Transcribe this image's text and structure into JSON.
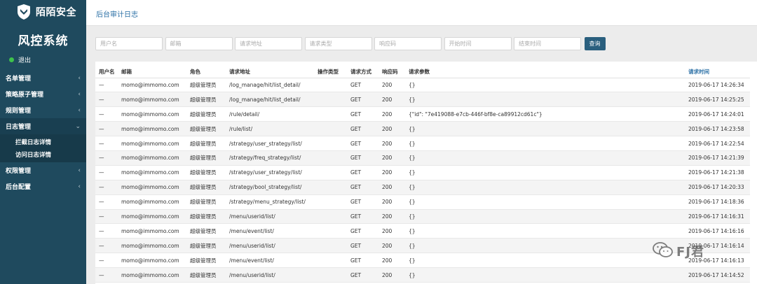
{
  "brand": {
    "name": "陌陌安全",
    "system_title": "风控系统",
    "logout": "退出"
  },
  "nav": [
    {
      "label": "名单管理",
      "open": false,
      "children": []
    },
    {
      "label": "策略原子管理",
      "open": false,
      "children": []
    },
    {
      "label": "规则管理",
      "open": false,
      "children": []
    },
    {
      "label": "日志管理",
      "open": true,
      "children": [
        "拦截日志详情",
        "访问日志详情"
      ]
    },
    {
      "label": "权限管理",
      "open": false,
      "children": []
    },
    {
      "label": "后台配置",
      "open": false,
      "children": []
    }
  ],
  "header": {
    "title": "后台审计日志"
  },
  "filters": {
    "username": "用户名",
    "email": "邮箱",
    "path": "请求地址",
    "type": "请求类型",
    "code": "响应码",
    "start": "开始时间",
    "end": "结束时间",
    "query": "查询"
  },
  "columns": [
    "用户名",
    "邮箱",
    "角色",
    "请求地址",
    "操作类型",
    "请求方式",
    "响应码",
    "请求参数",
    "请求时间"
  ],
  "rows": [
    {
      "user": "—",
      "email": "momo@immomo.com",
      "role": "超级管理员",
      "path": "/log_manage/hit/list_detail/",
      "op": "",
      "method": "GET",
      "code": "200",
      "params": "{}",
      "time": "2019-06-17 14:26:34"
    },
    {
      "user": "—",
      "email": "momo@immomo.com",
      "role": "超级管理员",
      "path": "/log_manage/hit/list_detail/",
      "op": "",
      "method": "GET",
      "code": "200",
      "params": "{}",
      "time": "2019-06-17 14:25:25"
    },
    {
      "user": "—",
      "email": "momo@immomo.com",
      "role": "超级管理员",
      "path": "/rule/detail/",
      "op": "",
      "method": "GET",
      "code": "200",
      "params": "{\"id\": \"7e419088-e7cb-446f-bf8e-ca89912cd61c\"}",
      "time": "2019-06-17 14:24:01"
    },
    {
      "user": "—",
      "email": "momo@immomo.com",
      "role": "超级管理员",
      "path": "/rule/list/",
      "op": "",
      "method": "GET",
      "code": "200",
      "params": "{}",
      "time": "2019-06-17 14:23:58"
    },
    {
      "user": "—",
      "email": "momo@immomo.com",
      "role": "超级管理员",
      "path": "/strategy/user_strategy/list/",
      "op": "",
      "method": "GET",
      "code": "200",
      "params": "{}",
      "time": "2019-06-17 14:22:54"
    },
    {
      "user": "—",
      "email": "momo@immomo.com",
      "role": "超级管理员",
      "path": "/strategy/freq_strategy/list/",
      "op": "",
      "method": "GET",
      "code": "200",
      "params": "{}",
      "time": "2019-06-17 14:21:39"
    },
    {
      "user": "—",
      "email": "momo@immomo.com",
      "role": "超级管理员",
      "path": "/strategy/user_strategy/list/",
      "op": "",
      "method": "GET",
      "code": "200",
      "params": "{}",
      "time": "2019-06-17 14:21:38"
    },
    {
      "user": "—",
      "email": "momo@immomo.com",
      "role": "超级管理员",
      "path": "/strategy/bool_strategy/list/",
      "op": "",
      "method": "GET",
      "code": "200",
      "params": "{}",
      "time": "2019-06-17 14:20:33"
    },
    {
      "user": "—",
      "email": "momo@immomo.com",
      "role": "超级管理员",
      "path": "/strategy/menu_strategy/list/",
      "op": "",
      "method": "GET",
      "code": "200",
      "params": "{}",
      "time": "2019-06-17 14:18:36"
    },
    {
      "user": "—",
      "email": "momo@immomo.com",
      "role": "超级管理员",
      "path": "/menu/userid/list/",
      "op": "",
      "method": "GET",
      "code": "200",
      "params": "{}",
      "time": "2019-06-17 14:16:31"
    },
    {
      "user": "—",
      "email": "momo@immomo.com",
      "role": "超级管理员",
      "path": "/menu/event/list/",
      "op": "",
      "method": "GET",
      "code": "200",
      "params": "{}",
      "time": "2019-06-17 14:16:16"
    },
    {
      "user": "—",
      "email": "momo@immomo.com",
      "role": "超级管理员",
      "path": "/menu/userid/list/",
      "op": "",
      "method": "GET",
      "code": "200",
      "params": "{}",
      "time": "2019-06-17 14:16:14"
    },
    {
      "user": "—",
      "email": "momo@immomo.com",
      "role": "超级管理员",
      "path": "/menu/event/list/",
      "op": "",
      "method": "GET",
      "code": "200",
      "params": "{}",
      "time": "2019-06-17 14:16:13"
    },
    {
      "user": "—",
      "email": "momo@immomo.com",
      "role": "超级管理员",
      "path": "/menu/userid/list/",
      "op": "",
      "method": "GET",
      "code": "200",
      "params": "{}",
      "time": "2019-06-17 14:14:52"
    }
  ],
  "watermark": "FJ君",
  "colors": {
    "sidebar": "#1f4a5e",
    "accent": "#2a6fa5",
    "button": "#2a5f7e",
    "status": "#3ec24b"
  }
}
